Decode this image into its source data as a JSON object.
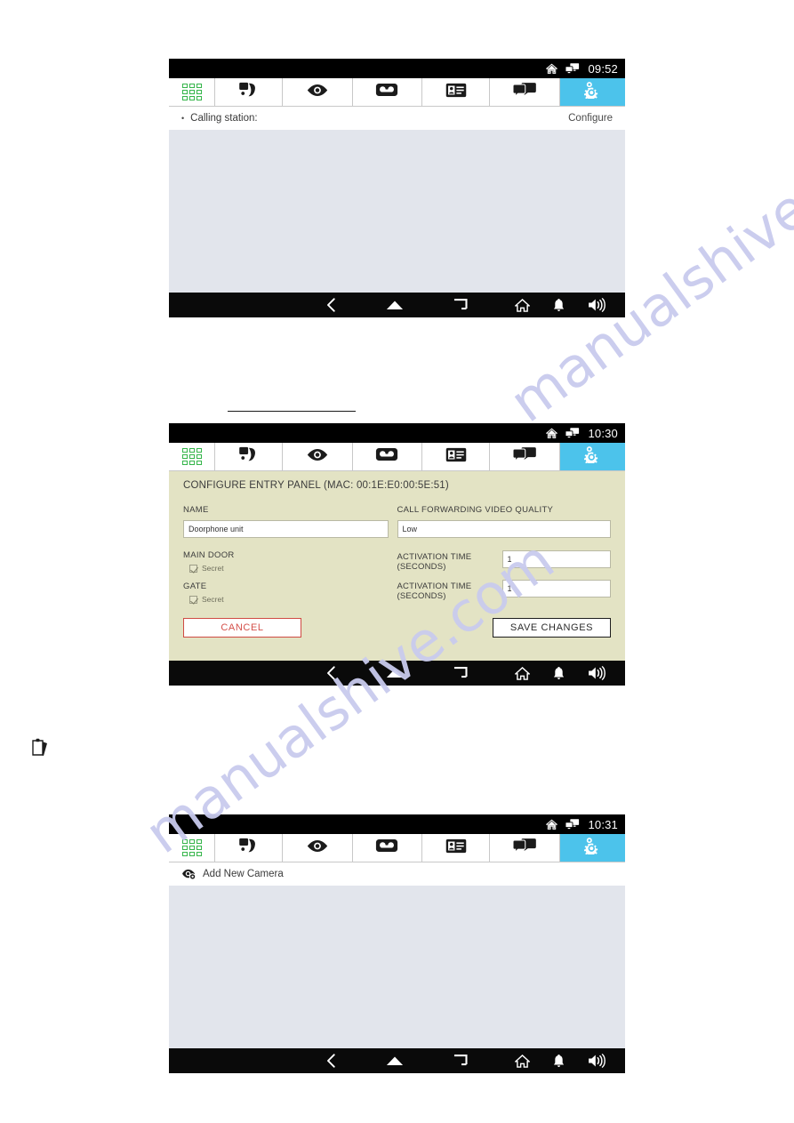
{
  "watermark": {
    "text": "manualshive.com",
    "color": "#c9cbee"
  },
  "theme": {
    "accent_cyan": "#4cc3eb",
    "form_khaki": "#e3e3c4",
    "content_gray": "#e2e5ec",
    "cancel_red": "#d4504a",
    "grid_green": "#35b54a"
  },
  "tabs": [
    {
      "name": "apps-grid",
      "icon": "grid-icon"
    },
    {
      "name": "doorphone",
      "icon": "phone-door-icon"
    },
    {
      "name": "camera-view",
      "icon": "eye-icon"
    },
    {
      "name": "answering-machine",
      "icon": "answering-machine-icon"
    },
    {
      "name": "contacts",
      "icon": "contact-card-icon"
    },
    {
      "name": "messages",
      "icon": "chat-bubbles-icon"
    },
    {
      "name": "settings",
      "icon": "gears-icon",
      "active": true
    }
  ],
  "navbar": {
    "back": "back-arrow-icon",
    "home": "home-dome-icon",
    "recents": "recents-icon",
    "house": "house-icon",
    "bell": "bell-icon",
    "volume": "volume-icon"
  },
  "screens": [
    {
      "id": "screen-calling-station",
      "status": {
        "time": "09:52",
        "icons": [
          "house-icon",
          "monitors-icon"
        ]
      },
      "subrow": {
        "bullet": "•",
        "label": "Calling station:",
        "right_link": "Configure"
      },
      "content": "blank"
    },
    {
      "id": "screen-configure-entry-panel",
      "status": {
        "time": "10:30",
        "icons": [
          "house-icon",
          "monitors-icon"
        ]
      },
      "form": {
        "title": "CONFIGURE ENTRY PANEL (MAC: 00:1E:E0:00:5E:51)",
        "name_label": "NAME",
        "name_value": "Doorphone unit",
        "video_quality_label": "CALL FORWARDING VIDEO QUALITY",
        "video_quality_value": "Low",
        "doors": [
          {
            "title": "MAIN DOOR",
            "secret_label": "Secret",
            "secret_checked": true,
            "activation_label": "ACTIVATION TIME (SECONDS)",
            "activation_label_line1": "ACTIVATION TIME",
            "activation_label_line2": "(SECONDS)",
            "activation_value": "1"
          },
          {
            "title": "GATE",
            "secret_label": "Secret",
            "secret_checked": true,
            "activation_label": "ACTIVATION TIME (SECONDS)",
            "activation_label_line1": "ACTIVATION TIME",
            "activation_label_line2": "(SECONDS)",
            "activation_value": "1"
          }
        ],
        "cancel_label": "CANCEL",
        "save_label": "SAVE CHANGES"
      }
    },
    {
      "id": "screen-add-camera",
      "status": {
        "time": "10:31",
        "icons": [
          "house-icon",
          "monitors-icon"
        ]
      },
      "subrow": {
        "label": "Add New Camera",
        "icon": "camera-eye-icon"
      },
      "content": "blank"
    }
  ]
}
